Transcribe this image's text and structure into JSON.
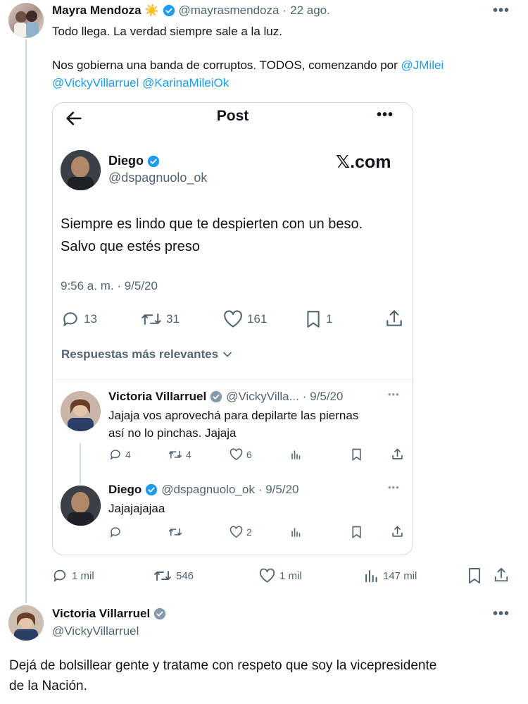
{
  "main_tweet": {
    "name": "Mayra Mendoza",
    "sun_emoji": "☀️",
    "handle": "@mayrasmendoza",
    "separator": "·",
    "date": "22 ago.",
    "line1": "Todo llega. La verdad siempre sale a la luz.",
    "line2_prefix": "Nos gobierna una banda de corruptos. TODOS, comenzando por",
    "mention1": "@JMilei",
    "mention2": "@VickyVillarruel",
    "mention3": "@KarinaMileiOk",
    "more": "•••"
  },
  "card": {
    "header_title": "Post",
    "more": "•••",
    "author_name": "Diego",
    "author_handle": "@dspagnuolo_ok",
    "brand": "𝕏.com",
    "text_line1": "Siempre es lindo que te despierten con un beso.",
    "text_line2": "Salvo que estés preso",
    "timestamp": "9:56 a. m. · 9/5/20",
    "stats": {
      "replies": "13",
      "retweets": "31",
      "likes": "161",
      "bookmarks": "1"
    },
    "sort_label": "Respuestas más relevantes",
    "reply1": {
      "name": "Victoria Villarruel",
      "handle": "@VickyVilla...",
      "date": "· 9/5/20",
      "text_line1": "Jajaja vos aprovechá para depilarte las piernas",
      "text_line2": "así no lo pinchas. Jajaja",
      "replies": "4",
      "retweets": "4",
      "likes": "6"
    },
    "reply2": {
      "name": "Diego",
      "handle": "@dspagnuolo_ok",
      "date": "· 9/5/20",
      "text": "Jajajajajaa",
      "likes": "2"
    }
  },
  "main_stats": {
    "replies": "1 mil",
    "retweets": "546",
    "likes": "1 mil",
    "views": "147 mil"
  },
  "reply_tweet": {
    "name": "Victoria Villarruel",
    "handle": "@VickyVillarruel",
    "more": "•••",
    "text_line1": "Dejá de bolsillear gente y tratame con respeto que soy la vicepresidente",
    "text_line2": "de la Nación."
  },
  "colors": {
    "link": "#1d9bf0",
    "muted": "#536471",
    "verified_blue": "#1d9bf0",
    "verified_gray": "#829aab",
    "border": "#cfd9de"
  }
}
